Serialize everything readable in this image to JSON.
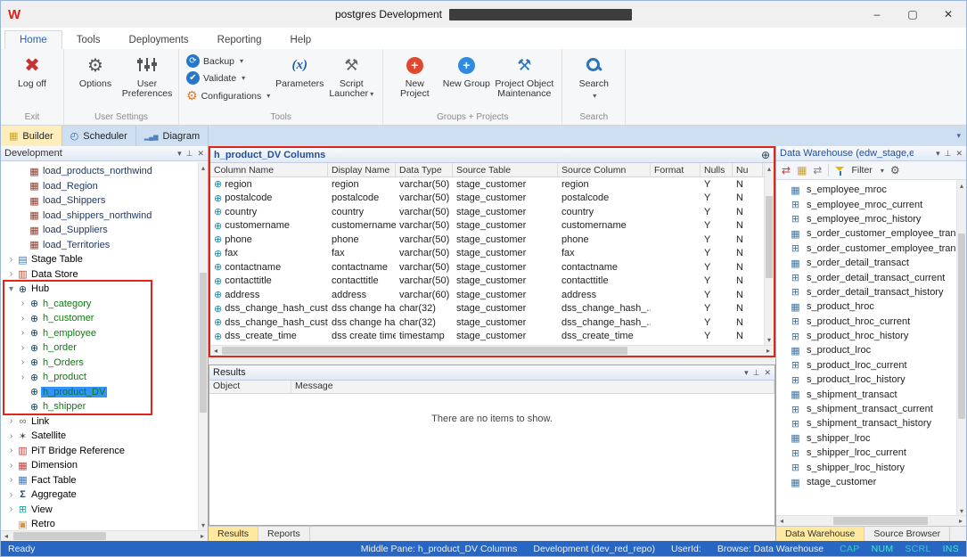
{
  "icons": {
    "chevron_down": "▾",
    "pin": "⊥",
    "close_small": "✕",
    "logoff": "✖",
    "gear": "⚙",
    "refresh": "⟳",
    "check": "✔",
    "parameters": "(x)",
    "hammer": "⚒",
    "plus": "+",
    "globe": "⊕",
    "tree_collapsed": "›",
    "tree_expanded": "▾",
    "minimize": "–",
    "maximize": "▢",
    "close": "✕"
  },
  "titlebar": {
    "title": "postgres Development"
  },
  "menu": {
    "tabs": [
      {
        "label": "Home",
        "active": true
      },
      {
        "label": "Tools"
      },
      {
        "label": "Deployments"
      },
      {
        "label": "Reporting"
      },
      {
        "label": "Help"
      }
    ]
  },
  "ribbon": {
    "logoff_label": "Log off",
    "options_label": "Options",
    "user_prefs_label": "User Preferences",
    "backup_label": "Backup",
    "validate_label": "Validate",
    "configurations_label": "Configurations",
    "parameters_label": "Parameters",
    "script_launcher_label": "Script Launcher",
    "new_project_label": "New Project",
    "new_group_label": "New Group",
    "project_object_maintenance_label": "Project Object Maintenance",
    "search_label": "Search",
    "group_labels": {
      "exit": "Exit",
      "user_settings": "User Settings",
      "tools": "Tools",
      "groups_projects": "Groups + Projects",
      "search": "Search"
    }
  },
  "view_tabs": [
    {
      "label": "Builder",
      "icon": "builder",
      "active": true
    },
    {
      "label": "Scheduler",
      "icon": "scheduler"
    },
    {
      "label": "Diagram",
      "icon": "diagram"
    }
  ],
  "left_panel": {
    "title": "Development",
    "tree": [
      {
        "label": "load_products_northwind",
        "icon": "load-table",
        "indent": 1,
        "cls": "load"
      },
      {
        "label": "load_Region",
        "icon": "load-table",
        "indent": 1,
        "cls": "load"
      },
      {
        "label": "load_Shippers",
        "icon": "load-table",
        "indent": 1,
        "cls": "load"
      },
      {
        "label": "load_shippers_northwind",
        "icon": "load-table",
        "indent": 1,
        "cls": "load"
      },
      {
        "label": "load_Suppliers",
        "icon": "load-table",
        "indent": 1,
        "cls": "load"
      },
      {
        "label": "load_Territories",
        "icon": "load-table",
        "indent": 1,
        "cls": "load"
      },
      {
        "label": "Stage Table",
        "icon": "stage-table",
        "indent": 0,
        "chev": "c",
        "cls": "cat"
      },
      {
        "label": "Data Store",
        "icon": "data-store",
        "indent": 0,
        "chev": "c",
        "cls": "cat"
      },
      {
        "label": "Hub",
        "icon": "hub",
        "indent": 0,
        "chev": "e",
        "cls": "cat"
      },
      {
        "label": "h_category",
        "icon": "hub",
        "indent": 1,
        "chev": "c",
        "cls": "hub"
      },
      {
        "label": "h_customer",
        "icon": "hub",
        "indent": 1,
        "chev": "c",
        "cls": "hub"
      },
      {
        "label": "h_employee",
        "icon": "hub",
        "indent": 1,
        "chev": "c",
        "cls": "hub"
      },
      {
        "label": "h_order",
        "icon": "hub",
        "indent": 1,
        "chev": "c",
        "cls": "hub"
      },
      {
        "label": "h_Orders",
        "icon": "hub",
        "indent": 1,
        "chev": "c",
        "cls": "hub"
      },
      {
        "label": "h_product",
        "icon": "hub",
        "indent": 1,
        "chev": "c",
        "cls": "hub"
      },
      {
        "label": "h_product_DV",
        "icon": "hub",
        "indent": 1,
        "cls": "hub",
        "selected": true
      },
      {
        "label": "h_shipper",
        "icon": "hub",
        "indent": 1,
        "cls": "hub"
      },
      {
        "label": "Link",
        "icon": "link",
        "indent": 0,
        "chev": "c",
        "cls": "cat"
      },
      {
        "label": "Satellite",
        "icon": "satellite",
        "indent": 0,
        "chev": "c",
        "cls": "cat"
      },
      {
        "label": "PiT Bridge Reference",
        "icon": "pit-bridge",
        "indent": 0,
        "chev": "c",
        "cls": "cat"
      },
      {
        "label": "Dimension",
        "icon": "dimension",
        "indent": 0,
        "chev": "c",
        "cls": "cat"
      },
      {
        "label": "Fact Table",
        "icon": "fact-table",
        "indent": 0,
        "chev": "c",
        "cls": "cat"
      },
      {
        "label": "Aggregate",
        "icon": "aggregate",
        "indent": 0,
        "chev": "c",
        "cls": "cat"
      },
      {
        "label": "View",
        "icon": "view",
        "indent": 0,
        "chev": "c",
        "cls": "cat"
      },
      {
        "label": "Retro",
        "icon": "retro",
        "indent": 0,
        "cls": "cat"
      }
    ]
  },
  "columns_pane": {
    "title": "h_product_DV Columns",
    "headers": [
      "Column Name",
      "Display Name",
      "Data Type",
      "Source Table",
      "Source Column",
      "Format",
      "Nulls",
      "Nu"
    ],
    "rows": [
      [
        "region",
        "region",
        "varchar(50)",
        "stage_customer",
        "region",
        "",
        "Y",
        "N"
      ],
      [
        "postalcode",
        "postalcode",
        "varchar(50)",
        "stage_customer",
        "postalcode",
        "",
        "Y",
        "N"
      ],
      [
        "country",
        "country",
        "varchar(50)",
        "stage_customer",
        "country",
        "",
        "Y",
        "N"
      ],
      [
        "customername",
        "customername",
        "varchar(50)",
        "stage_customer",
        "customername",
        "",
        "Y",
        "N"
      ],
      [
        "phone",
        "phone",
        "varchar(50)",
        "stage_customer",
        "phone",
        "",
        "Y",
        "N"
      ],
      [
        "fax",
        "fax",
        "varchar(50)",
        "stage_customer",
        "fax",
        "",
        "Y",
        "N"
      ],
      [
        "contactname",
        "contactname",
        "varchar(50)",
        "stage_customer",
        "contactname",
        "",
        "Y",
        "N"
      ],
      [
        "contacttitle",
        "contacttitle",
        "varchar(50)",
        "stage_customer",
        "contacttitle",
        "",
        "Y",
        "N"
      ],
      [
        "address",
        "address",
        "varchar(60)",
        "stage_customer",
        "address",
        "",
        "Y",
        "N"
      ],
      [
        "dss_change_hash_custo...",
        "dss change ha...",
        "char(32)",
        "stage_customer",
        "dss_change_hash_...",
        "",
        "Y",
        "N"
      ],
      [
        "dss_change_hash_custo...",
        "dss change ha...",
        "char(32)",
        "stage_customer",
        "dss_change_hash_...",
        "",
        "Y",
        "N"
      ],
      [
        "dss_create_time",
        "dss create time",
        "timestamp",
        "stage_customer",
        "dss_create_time",
        "",
        "Y",
        "N"
      ]
    ]
  },
  "results_pane": {
    "title": "Results",
    "headers": [
      "Object",
      "Message"
    ],
    "empty_text": "There are no items to show.",
    "tabs": [
      {
        "label": "Results",
        "active": true
      },
      {
        "label": "Reports"
      }
    ]
  },
  "right_panel": {
    "title": "Data Warehouse (edw_stage,edw_ods...",
    "filter_label": "Filter",
    "items": [
      {
        "label": "s_employee_mroc",
        "icon": "table"
      },
      {
        "label": "s_employee_mroc_current",
        "icon": "table-view"
      },
      {
        "label": "s_employee_mroc_history",
        "icon": "table-view"
      },
      {
        "label": "s_order_customer_employee_tran",
        "icon": "table"
      },
      {
        "label": "s_order_customer_employee_tran",
        "icon": "table-view"
      },
      {
        "label": "s_order_detail_transact",
        "icon": "table"
      },
      {
        "label": "s_order_detail_transact_current",
        "icon": "table-view"
      },
      {
        "label": "s_order_detail_transact_history",
        "icon": "table-view"
      },
      {
        "label": "s_product_hroc",
        "icon": "table"
      },
      {
        "label": "s_product_hroc_current",
        "icon": "table-view"
      },
      {
        "label": "s_product_hroc_history",
        "icon": "table-view"
      },
      {
        "label": "s_product_lroc",
        "icon": "table"
      },
      {
        "label": "s_product_lroc_current",
        "icon": "table-view"
      },
      {
        "label": "s_product_lroc_history",
        "icon": "table-view"
      },
      {
        "label": "s_shipment_transact",
        "icon": "table"
      },
      {
        "label": "s_shipment_transact_current",
        "icon": "table-view"
      },
      {
        "label": "s_shipment_transact_history",
        "icon": "table-view"
      },
      {
        "label": "s_shipper_lroc",
        "icon": "table"
      },
      {
        "label": "s_shipper_lroc_current",
        "icon": "table-view"
      },
      {
        "label": "s_shipper_lroc_history",
        "icon": "table-view"
      },
      {
        "label": "stage_customer",
        "icon": "table"
      }
    ],
    "tabs": [
      {
        "label": "Data Warehouse",
        "active": true
      },
      {
        "label": "Source Browser"
      }
    ]
  },
  "statusbar": {
    "ready": "Ready",
    "items": [
      "Middle Pane: h_product_DV Columns",
      "Development (dev_red_repo)",
      "UserId:",
      "Browse: Data Warehouse"
    ],
    "flags": [
      {
        "label": "CAP",
        "dim": true
      },
      {
        "label": "NUM"
      },
      {
        "label": "SCRL",
        "dim": true
      },
      {
        "label": "INS"
      }
    ]
  }
}
